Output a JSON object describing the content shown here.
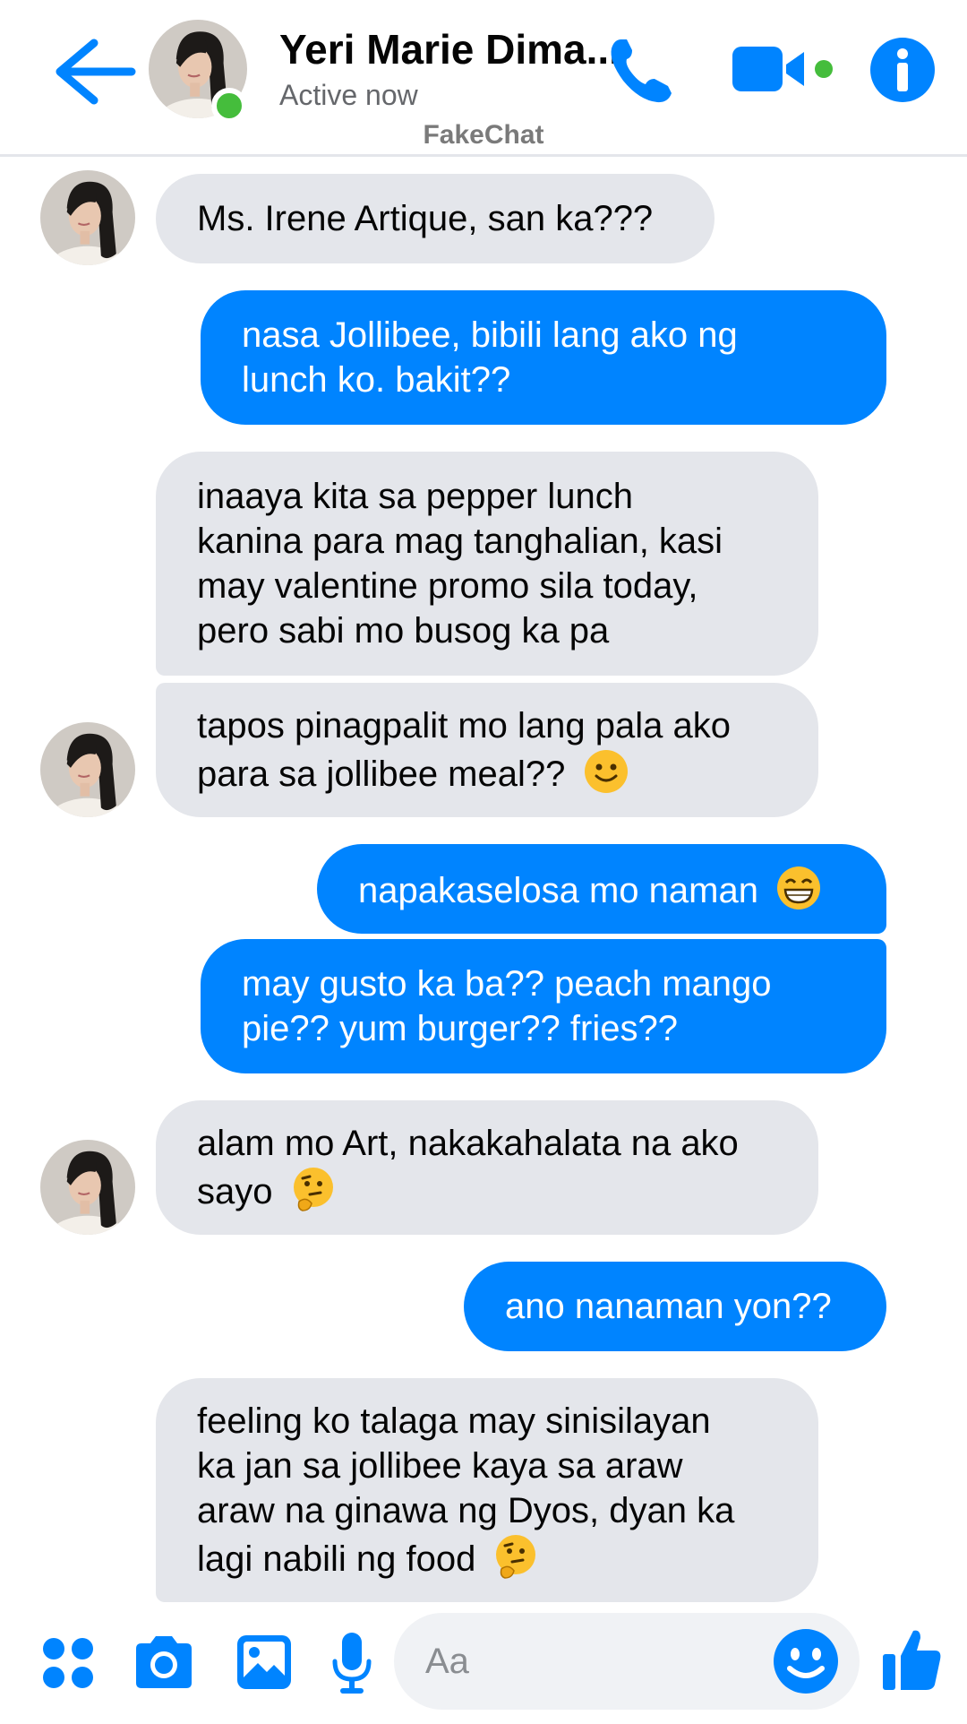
{
  "header": {
    "contact_name": "Yeri Marie Dima...",
    "status": "Active now",
    "watermark": "FakeChat"
  },
  "messages": [
    {
      "from": "them",
      "lines": [
        "Ms. Irene Artique, san ka???"
      ]
    },
    {
      "from": "me",
      "lines": [
        "nasa Jollibee, bibili lang ako ng",
        "lunch ko. bakit??"
      ]
    },
    {
      "from": "them",
      "lines": [
        "inaaya kita sa pepper lunch",
        "kanina para mag tanghalian, kasi",
        "may valentine promo sila today,",
        "pero sabi mo busog ka pa"
      ]
    },
    {
      "from": "them",
      "lines": [
        "tapos pinagpalit mo lang pala ako",
        "para sa jollibee meal??"
      ],
      "emoji": "slight-smile"
    },
    {
      "from": "me",
      "lines": [
        "napakaselosa mo naman"
      ],
      "emoji": "grin"
    },
    {
      "from": "me",
      "lines": [
        "may gusto ka ba?? peach mango",
        "pie?? yum burger?? fries??"
      ]
    },
    {
      "from": "them",
      "lines": [
        "alam mo Art, nakakahalata na ako",
        "sayo"
      ],
      "emoji": "thinking"
    },
    {
      "from": "me",
      "lines": [
        "ano nanaman yon??"
      ]
    },
    {
      "from": "them",
      "lines": [
        "feeling ko talaga may sinisilayan",
        "ka jan sa jollibee kaya sa araw",
        "araw na ginawa ng Dyos, dyan ka",
        "lagi nabili ng food"
      ],
      "emoji": "thinking"
    }
  ],
  "composer": {
    "placeholder": "Aa"
  },
  "icons": [
    "back-arrow-icon",
    "phone-icon",
    "video-camera-icon",
    "info-icon",
    "apps-grid-icon",
    "camera-icon",
    "gallery-icon",
    "microphone-icon",
    "emoji-icon",
    "thumbs-up-icon"
  ],
  "colors": {
    "accent": "#0084ff",
    "incoming_bubble": "#e4e6eb",
    "online": "#45bd3c"
  }
}
